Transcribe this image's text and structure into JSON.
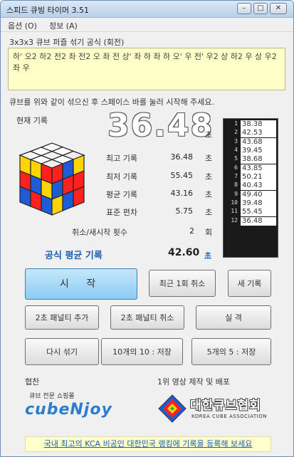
{
  "window": {
    "title": "스피드 큐빙 타이머 3.51"
  },
  "menu": {
    "items": [
      "옵션 (O)",
      "정보 (A)"
    ]
  },
  "scramble": {
    "label": "3x3x3 큐브 퍼즐 섞기 공식 (회전)",
    "text": "하' 오2 하2 전2 좌 전2 오 좌 전 상' 좌 하 좌 하 오' 우 전' 우2 상 하2 우 상 우2 좌 우"
  },
  "hint": "큐브를 위와 같이 섞으신 후 스페이스 바를 눌러 시작해 주세요.",
  "current": {
    "label": "현재 기록",
    "time": "36.48",
    "unit": "초"
  },
  "stats": [
    {
      "label": "최고 기록",
      "value": "36.48",
      "unit": "초"
    },
    {
      "label": "최저 기록",
      "value": "55.45",
      "unit": "초"
    },
    {
      "label": "평균 기록",
      "value": "43.16",
      "unit": "초"
    },
    {
      "label": "표준 편차",
      "value": "5.75",
      "unit": "초"
    },
    {
      "label": "취소/새시작 횟수",
      "value": "2",
      "unit": "회"
    }
  ],
  "official": {
    "label": "공식 평균 기록",
    "value": "42.60",
    "unit": "초"
  },
  "records": [
    {
      "idx": "1",
      "value": "38.38"
    },
    {
      "idx": "2",
      "value": "42.53"
    },
    {
      "idx": "3",
      "value": "43.68"
    },
    {
      "idx": "4",
      "value": "39.45"
    },
    {
      "idx": "5",
      "value": "38.68"
    },
    {
      "idx": "6",
      "value": "43.85"
    },
    {
      "idx": "7",
      "value": "50.21"
    },
    {
      "idx": "8",
      "value": "40.43"
    },
    {
      "idx": "9",
      "value": "49.40"
    },
    {
      "idx": "10",
      "value": "39.48"
    },
    {
      "idx": "11",
      "value": "55.45"
    },
    {
      "idx": "12",
      "value": "36.48"
    }
  ],
  "buttons": {
    "start": "시 작",
    "cancel": "최근 1회 취소",
    "new_record": "새 기록",
    "add2": "2초 패널티 추가",
    "cancel2": "2초 패널티 취소",
    "dnf": "실 격",
    "rescramble": "다시 섞기",
    "open10": "10개의 10 : 저장",
    "open5": "5개의 5 : 저장"
  },
  "sponsor": {
    "label": "협찬",
    "small_text": "큐브 전문 쇼핑몰",
    "brand": "cubeNjoy"
  },
  "video": {
    "label": "1위 영상 제작 및 배포"
  },
  "association": {
    "name_ko": "대한큐브협회",
    "name_en": "KOREA CUBE ASSOCIATION"
  },
  "footer": {
    "text": "국내 최고의 KCA 비공인 대한민국 랭킹에 기록을 등록해 보세요"
  },
  "colors": {
    "accent_blue": "#1a5fb4",
    "start_button": "#8bccf3",
    "scramble_bg": "#ffffc8",
    "footer_bg": "#ffffcc"
  }
}
